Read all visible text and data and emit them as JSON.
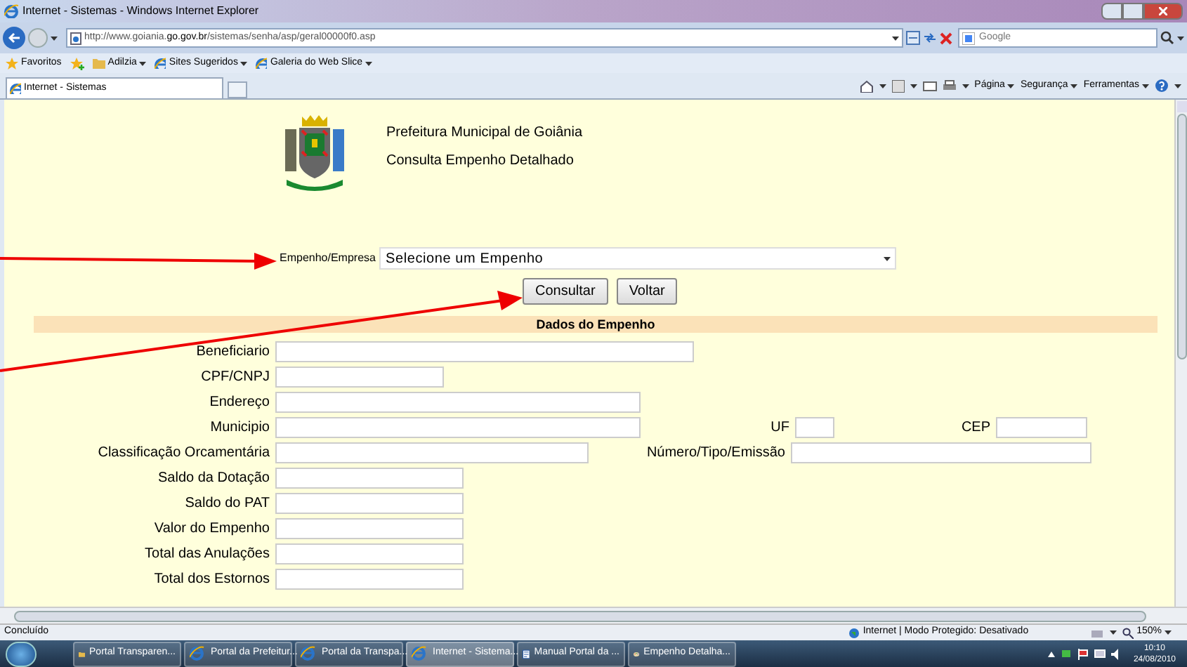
{
  "window": {
    "title": "Internet - Sistemas - Windows Internet Explorer"
  },
  "address_bar": {
    "url_prefix": "http://www.goiania.",
    "url_domain": "go.gov.br",
    "url_path": "/sistemas/senha/asp/geral00000f0.asp",
    "search_placeholder": "Google"
  },
  "favorites_bar": {
    "favorites": "Favoritos",
    "items": [
      {
        "label": "Adilzia",
        "kind": "folder"
      },
      {
        "label": "Sites Sugeridos",
        "kind": "page"
      },
      {
        "label": "Galeria do Web Slice",
        "kind": "page"
      }
    ]
  },
  "tabs": [
    {
      "label": "Internet - Sistemas",
      "selected": true
    }
  ],
  "command_bar": [
    "Página",
    "Segurança",
    "Ferramentas"
  ],
  "page": {
    "header": [
      "Prefeitura Municipal de Goiânia",
      "Consulta Empenho Detalhado"
    ],
    "selector": {
      "label": "Empenho/Empresa",
      "value": "Selecione um Empenho"
    },
    "buttons": [
      "Consultar",
      "Voltar"
    ],
    "section_title": "Dados do Empenho",
    "rows": [
      [
        {
          "label": "Beneficiario",
          "kind": "wide"
        }
      ],
      [
        {
          "label": "CPF/CNPJ",
          "kind": "short"
        }
      ],
      [
        {
          "label": "Endereço",
          "kind": "large"
        }
      ],
      [
        {
          "label": "Municipio",
          "kind": "large"
        },
        {
          "label": "UF",
          "kind": "tiny"
        },
        {
          "label": "CEP",
          "kind": "small"
        }
      ],
      [
        {
          "label": "Classificação Orcamentária",
          "kind": "medium"
        },
        {
          "label": "Número/Tipo/Emissão",
          "kind": "long"
        }
      ],
      [
        {
          "label": "Saldo da Dotação",
          "kind": "money"
        }
      ],
      [
        {
          "label": "Saldo do PAT",
          "kind": "money"
        }
      ],
      [
        {
          "label": "Valor do Empenho",
          "kind": "money"
        }
      ],
      [
        {
          "label": "Total das Anulações",
          "kind": "money"
        }
      ],
      [
        {
          "label": "Total dos Estornos",
          "kind": "money"
        }
      ]
    ]
  },
  "status_bar": {
    "status": "Concluído",
    "zone": "Internet | Modo Protegido: Desativado",
    "zoom": "150%"
  },
  "taskbar": {
    "items": [
      {
        "label": "Portal Transparen...",
        "kind": "folder",
        "selected": false
      },
      {
        "label": "Portal da Prefeitur...",
        "kind": "browser",
        "selected": false
      },
      {
        "label": "Portal da Transpa...",
        "kind": "browser",
        "selected": false
      },
      {
        "label": "Internet - Sistema...",
        "kind": "browser",
        "selected": true
      },
      {
        "label": "Manual Portal da ...",
        "kind": "document",
        "selected": false
      },
      {
        "label": "Empenho Detalha...",
        "kind": "paint",
        "selected": false
      }
    ],
    "time": "10:10",
    "date": "24/08/2010"
  }
}
